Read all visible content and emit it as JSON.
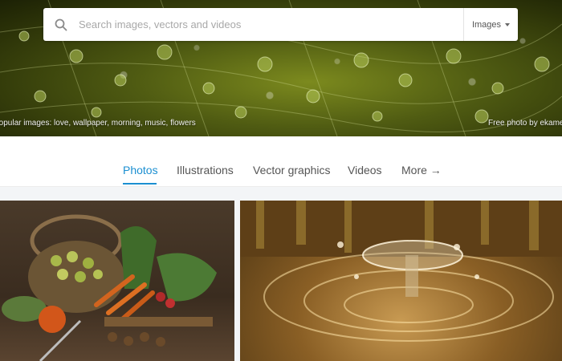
{
  "search": {
    "placeholder": "Search images, vectors and videos",
    "type_selected": "Images"
  },
  "hero": {
    "popular_text": "Popular images: love, wallpaper, morning, music, flowers",
    "credit_text": "Free photo by ekamelev"
  },
  "tabs": [
    {
      "label": "Photos",
      "active": true
    },
    {
      "label": "Illustrations",
      "active": false
    },
    {
      "label": "Vector graphics",
      "active": false
    },
    {
      "label": "Videos",
      "active": false
    },
    {
      "label": "More →",
      "active": false
    }
  ],
  "photos": [
    {
      "subject": "still life with vegetables and basket"
    },
    {
      "subject": "water droplet splash"
    }
  ],
  "icons": {
    "search": "search-icon",
    "caret": "caret-down-icon"
  },
  "colors": {
    "accent": "#1b8fd1",
    "hero": "#4f5b12"
  }
}
